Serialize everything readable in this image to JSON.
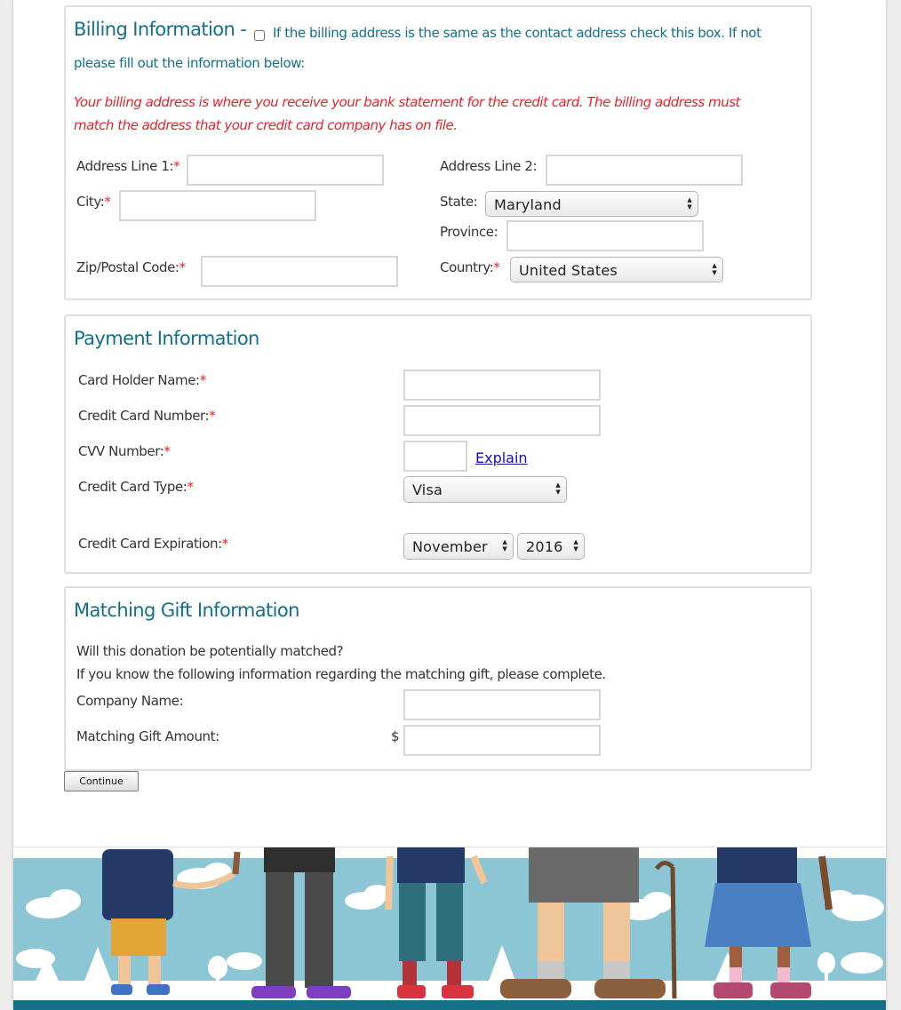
{
  "billing": {
    "title": "Billing Information -",
    "same_address_note_line1": "If the billing address is the same as the contact address check this box. If not",
    "same_address_note_line2": "please fill out the information below:",
    "warning_line1": "Your billing address is where you receive your bank statement for the credit card. The billing address must",
    "warning_line2": "match the address that your credit card company has on file.",
    "address1_label": "Address Line 1:",
    "address2_label": "Address Line 2:",
    "city_label": "City:",
    "state_label": "State:",
    "state_value": "Maryland",
    "province_label": "Province:",
    "zip_label": "Zip/Postal Code:",
    "country_label": "Country:",
    "country_value": "United States",
    "required_mark": "*"
  },
  "payment": {
    "title": "Payment Information",
    "holder_label": "Card Holder Name:",
    "number_label": "Credit Card Number:",
    "cvv_label": "CVV Number:",
    "explain_link": "Explain",
    "type_label": "Credit Card Type:",
    "type_value": "Visa",
    "expiration_label": "Credit Card Expiration:",
    "month_value": "November",
    "year_value": "2016"
  },
  "matching": {
    "title": "Matching Gift Information",
    "question": "Will this donation be potentially matched?",
    "instructions": "If you know the following information regarding the matching gift, please complete.",
    "company_label": "Company Name:",
    "amount_label": "Matching Gift Amount:",
    "currency_symbol": "$"
  },
  "continue_label": "Continue",
  "colors": {
    "accent": "#156f86",
    "required": "#e0262c",
    "link": "#1a0dab",
    "banner_sky": "#8cc6d4",
    "banner_bar": "#156f86"
  }
}
